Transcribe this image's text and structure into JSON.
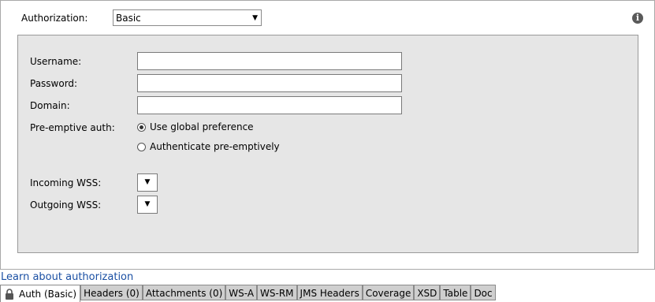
{
  "authorization": {
    "label": "Authorization:",
    "selected": "Basic"
  },
  "form": {
    "username_label": "Username:",
    "username_value": "",
    "password_label": "Password:",
    "password_value": "",
    "domain_label": "Domain:",
    "domain_value": "",
    "preemptive_label": "Pre-emptive auth:",
    "radio_global": "Use global preference",
    "radio_preemptive": "Authenticate pre-emptively",
    "incoming_wss_label": "Incoming WSS:",
    "outgoing_wss_label": "Outgoing WSS:"
  },
  "learn_link": "Learn about authorization",
  "tabs": [
    {
      "label": "Auth (Basic)",
      "active": true,
      "icon": "lock-icon"
    },
    {
      "label": "Headers (0)"
    },
    {
      "label": "Attachments (0)"
    },
    {
      "label": "WS-A"
    },
    {
      "label": "WS-RM"
    },
    {
      "label": "JMS Headers"
    },
    {
      "label": "Coverage"
    },
    {
      "label": "XSD"
    },
    {
      "label": "Table"
    },
    {
      "label": "Doc"
    }
  ]
}
